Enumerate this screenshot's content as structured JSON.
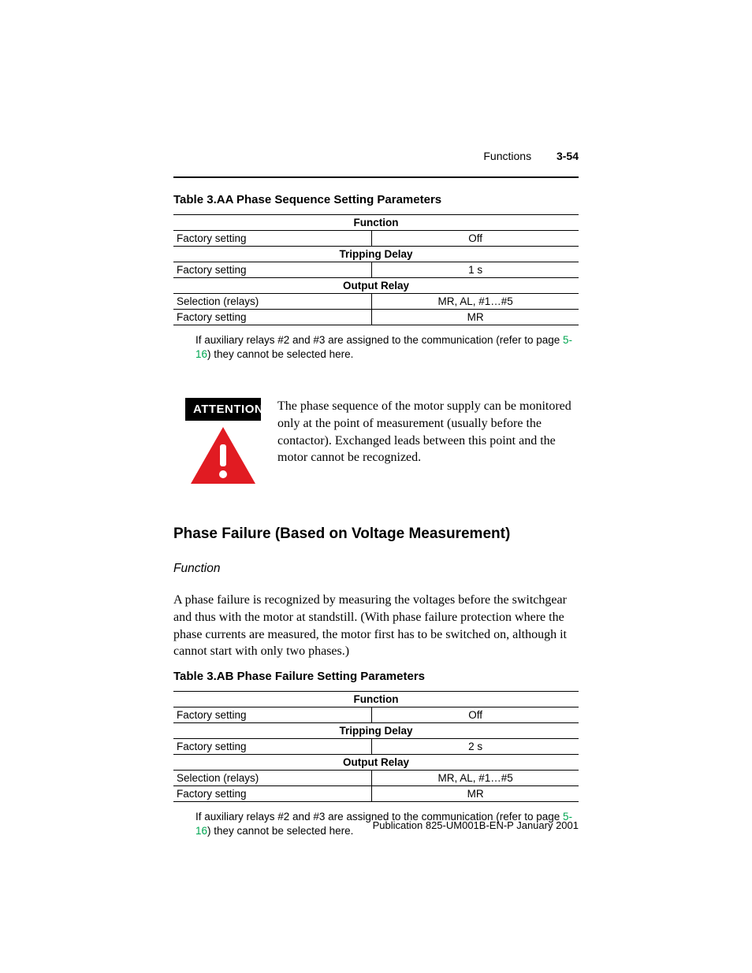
{
  "header": {
    "section": "Functions",
    "page_number": "3-54"
  },
  "table_aa": {
    "title": "Table 3.AA Phase Sequence Setting Parameters",
    "headers": {
      "h1": "Function",
      "h2": "Tripping Delay",
      "h3": "Output Relay"
    },
    "rows": {
      "r1_label": "Factory setting",
      "r1_value": "Off",
      "r2_label": "Factory setting",
      "r2_value": "1 s",
      "r3_label": "Selection (relays)",
      "r3_value": "MR, AL, #1…#5",
      "r4_label": "Factory setting",
      "r4_value": "MR"
    },
    "note_prefix": "If auxiliary relays #2 and #3 are assigned to the communication (refer to page ",
    "note_link": "5-16",
    "note_suffix": ") they cannot be selected here."
  },
  "attention": {
    "label": "ATTENTION",
    "text": "The phase sequence of the motor supply can be monitored only at the point of measurement (usually before the contactor). Exchanged leads between this point and the motor cannot be recognized."
  },
  "section2": {
    "heading": "Phase Failure (Based on Voltage Measurement)",
    "runin": "Function",
    "body": "A phase failure is recognized by measuring the voltages before the switchgear and thus with the motor at standstill. (With phase failure protection where the phase currents are measured, the motor first has to be switched on, although it cannot start with only two phases.)"
  },
  "table_ab": {
    "title": "Table 3.AB Phase Failure Setting Parameters",
    "headers": {
      "h1": "Function",
      "h2": "Tripping Delay",
      "h3": "Output Relay"
    },
    "rows": {
      "r1_label": "Factory setting",
      "r1_value": "Off",
      "r2_label": "Factory setting",
      "r2_value": "2 s",
      "r3_label": "Selection (relays)",
      "r3_value": "MR, AL, #1…#5",
      "r4_label": "Factory setting",
      "r4_value": "MR"
    },
    "note_prefix": "If auxiliary relays #2 and #3 are assigned to the communication (refer to page ",
    "note_link": "5-16",
    "note_suffix": ") they cannot be selected here."
  },
  "footer": "Publication 825-UM001B-EN-P  January 2001"
}
